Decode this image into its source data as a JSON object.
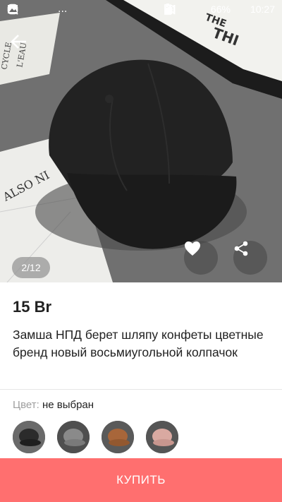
{
  "status_bar": {
    "left_icons": [
      "instagram-icon",
      "search-icon",
      "gallery-icon"
    ],
    "overflow": "...",
    "battery": "66%",
    "time": "10:27"
  },
  "gallery": {
    "indicator": "2/12",
    "card_texts": {
      "top_left_card": "CYCLE L'EAU",
      "left_card": "ALSO NI",
      "top_right_card": "THE THI"
    }
  },
  "product": {
    "price": "15 Br",
    "title": "Замша НПД берет шляпу конфеты цветные бренд новый восьмиугольной колпачок",
    "color_label": "Цвет:",
    "color_value": "не выбран",
    "swatches": [
      {
        "name": "black",
        "color": "#2b2b2b"
      },
      {
        "name": "gray",
        "color": "#8a8a8a"
      },
      {
        "name": "brown",
        "color": "#a8663a"
      },
      {
        "name": "pink",
        "color": "#d9a9a1"
      }
    ]
  },
  "actions": {
    "buy_label": "КУПИТЬ"
  },
  "colors": {
    "accent": "#ff6f6f",
    "text": "#212121",
    "muted": "#9e9e9e"
  }
}
